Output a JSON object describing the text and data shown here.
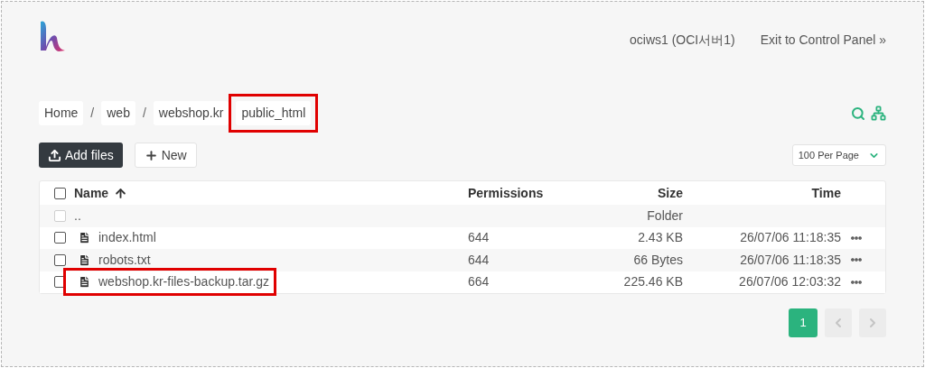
{
  "header": {
    "server": "ociws1 (OCI서버1)",
    "exit_link": "Exit to Control Panel »"
  },
  "breadcrumbs": {
    "items": [
      {
        "label": "Home",
        "highlighted": false
      },
      {
        "label": "web",
        "highlighted": false
      },
      {
        "label": "webshop.kr",
        "highlighted": false
      },
      {
        "label": "public_html",
        "highlighted": true
      }
    ],
    "separators": [
      "/",
      "/"
    ]
  },
  "toolbar": {
    "add_files": "Add files",
    "new": "New",
    "per_page": "100 Per Page"
  },
  "table": {
    "all_checked": false,
    "columns": [
      "Name",
      "Permissions",
      "Size",
      "Time"
    ],
    "rows": [
      {
        "kind": "parent",
        "name": "..",
        "size": "Folder",
        "checked": false,
        "disabled": true,
        "highlighted": false
      },
      {
        "kind": "file",
        "name": "index.html",
        "permissions": "644",
        "size": "2.43 KB",
        "time": "26/07/06 11:18:35",
        "checked": false,
        "disabled": false,
        "highlighted": false
      },
      {
        "kind": "file",
        "name": "robots.txt",
        "permissions": "644",
        "size": "66 Bytes",
        "time": "26/07/06 11:18:35",
        "checked": false,
        "disabled": false,
        "highlighted": false
      },
      {
        "kind": "file",
        "name": "webshop.kr-files-backup.tar.gz",
        "permissions": "664",
        "size": "225.46 KB",
        "time": "26/07/06 12:03:32",
        "checked": false,
        "disabled": false,
        "highlighted": true
      }
    ]
  },
  "pagination": {
    "pages": [
      {
        "label": "1",
        "selected": true
      }
    ]
  }
}
